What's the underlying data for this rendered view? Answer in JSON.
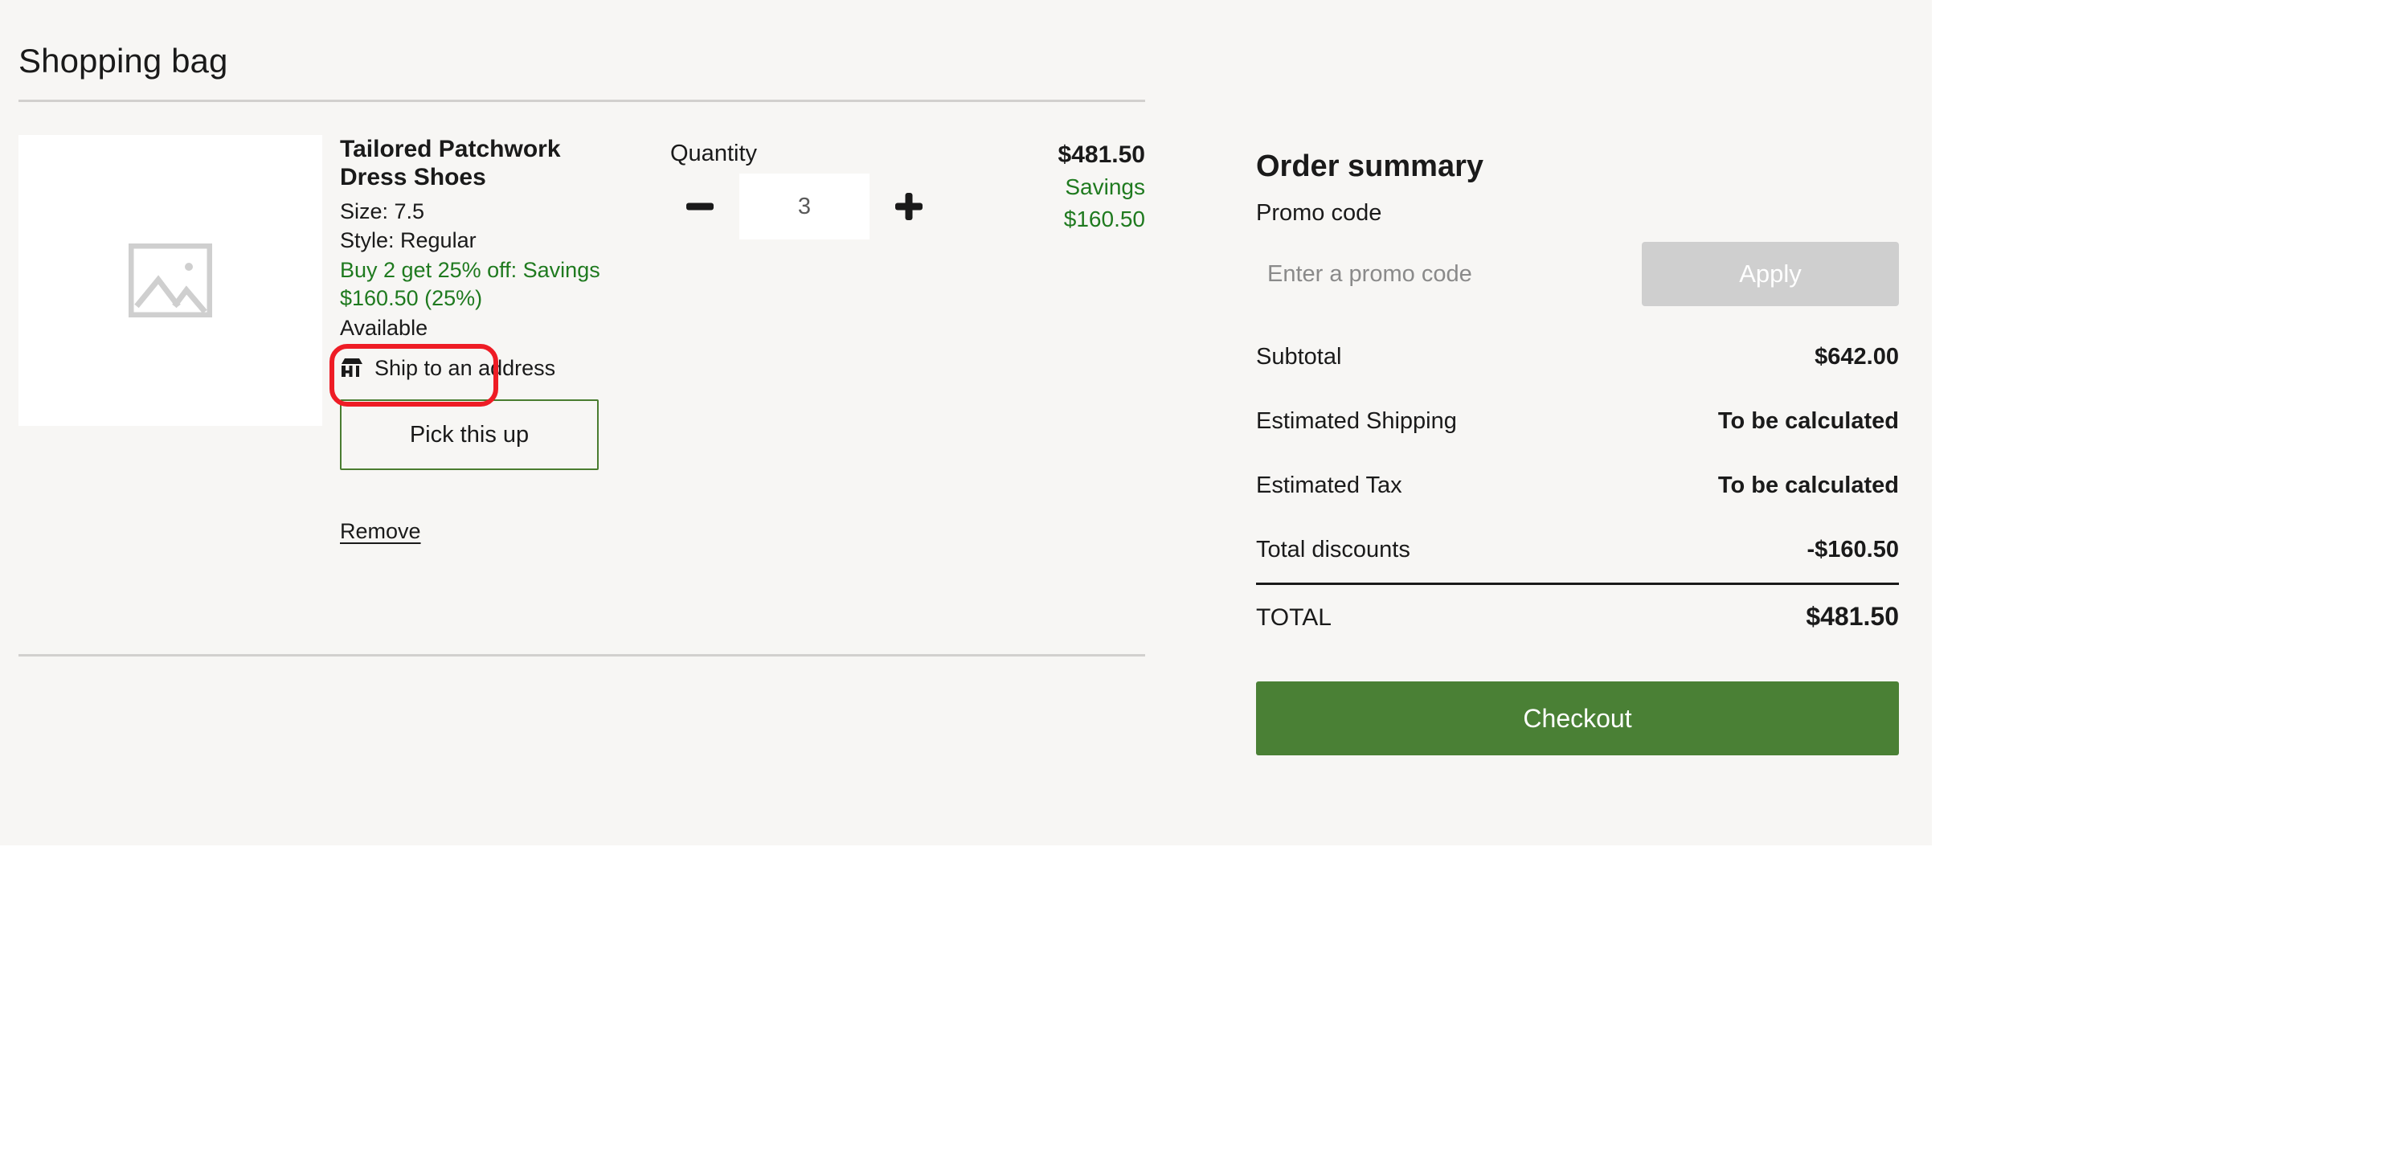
{
  "page": {
    "title": "Shopping bag"
  },
  "item": {
    "image_placeholder_icon": "image-placeholder-icon",
    "title": "Tailored Patchwork Dress Shoes",
    "size": "Size: 7.5",
    "style": "Style: Regular",
    "promo_text": "Buy 2 get 25% off: Savings $160.50 (25%)",
    "availability": "Available",
    "fulfillment_icon": "store-icon",
    "fulfillment_label": "Ship to an address",
    "pickup_button": "Pick this up",
    "remove_link": "Remove",
    "quantity_label": "Quantity",
    "quantity_value": "3",
    "decrease_icon": "minus-icon",
    "increase_icon": "plus-icon",
    "price": "$481.50",
    "savings_label": "Savings",
    "savings_value": "$160.50"
  },
  "summary": {
    "title": "Order summary",
    "promo_code_label": "Promo code",
    "promo_placeholder": "Enter a promo code",
    "apply_button": "Apply",
    "rows": [
      {
        "label": "Subtotal",
        "value": "$642.00"
      },
      {
        "label": "Estimated Shipping",
        "value": "To be calculated"
      },
      {
        "label": "Estimated Tax",
        "value": "To be calculated"
      },
      {
        "label": "Total discounts",
        "value": "-$160.50"
      }
    ],
    "total_label": "TOTAL",
    "total_value": "$481.50",
    "checkout_button": "Checkout"
  },
  "annotation": {
    "type": "highlight-box",
    "color": "#ee1c25",
    "target": "Available"
  },
  "colors": {
    "background": "#f7f6f4",
    "accent_green": "#4a8035",
    "savings_green": "#1f7a1f",
    "disabled_gray": "#cfcfcf",
    "annotation_red": "#ee1c25"
  }
}
